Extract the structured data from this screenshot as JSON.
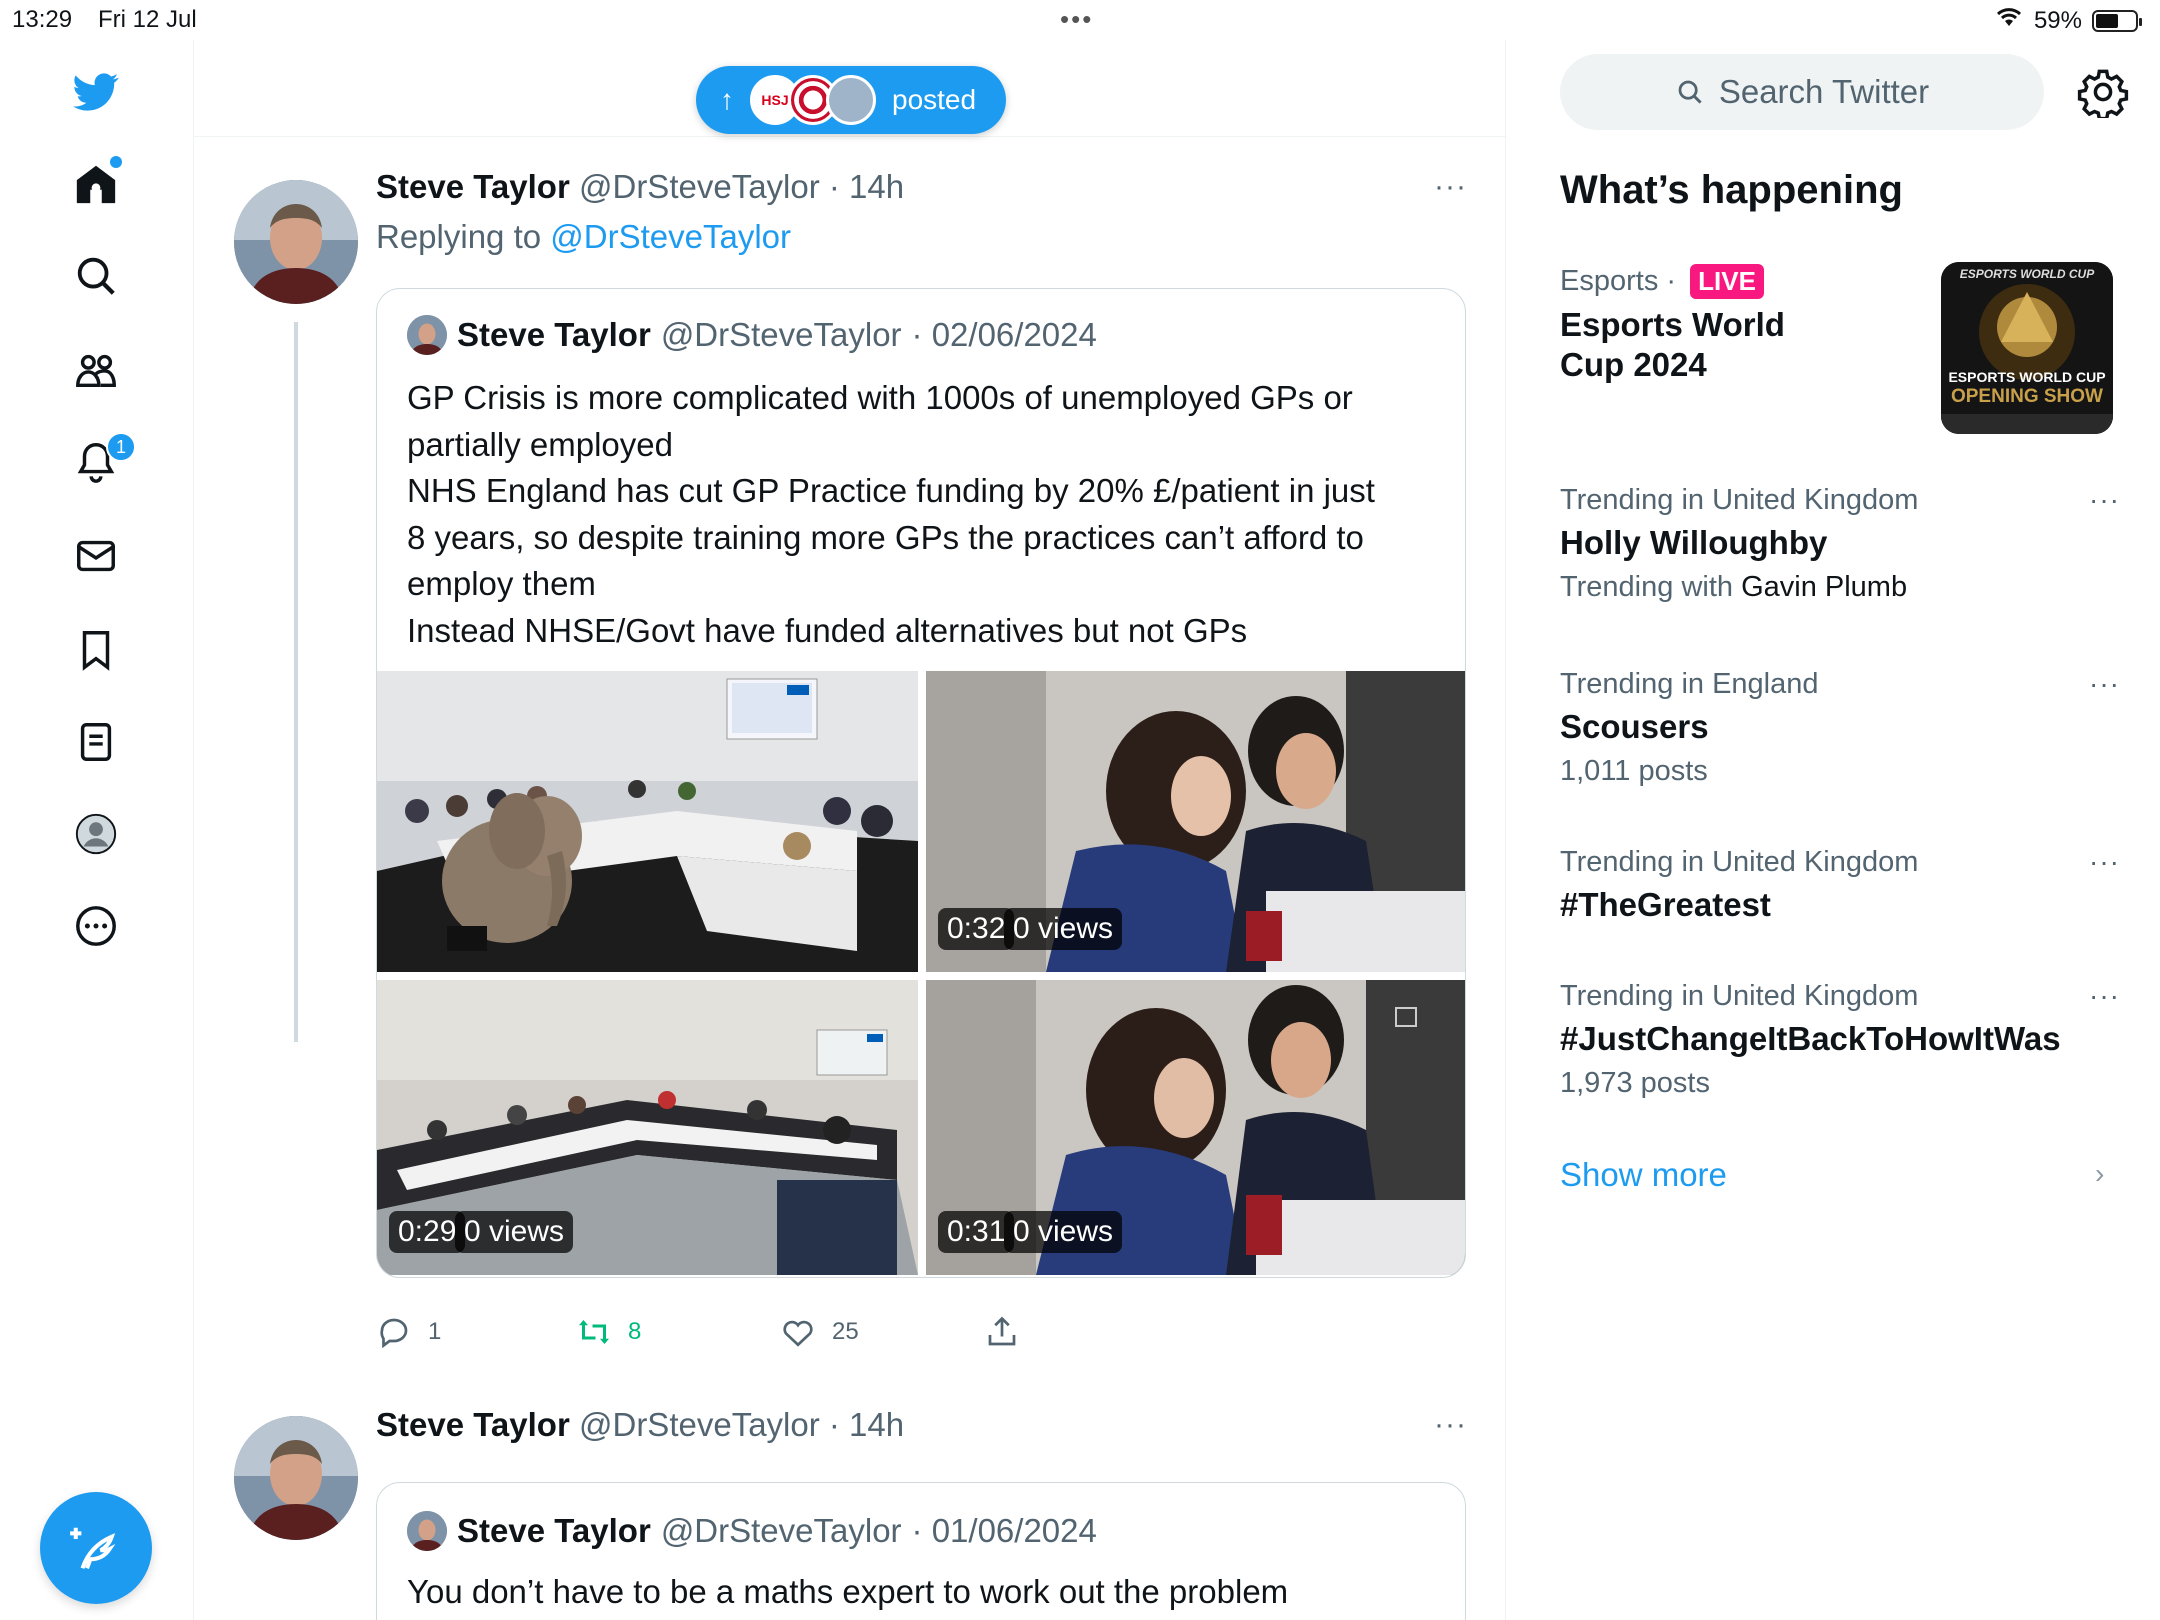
{
  "status_bar": {
    "time": "13:29",
    "date": "Fri 12 Jul",
    "battery": "59%",
    "battery_level": 0.59
  },
  "nav": {
    "notifications_badge": "1"
  },
  "topbar": {
    "posted_label": "posted",
    "pill_avatar_1": "HSJ"
  },
  "tweets": [
    {
      "name": "Steve Taylor",
      "handle": "@DrSteveTaylor",
      "time": "· 14h",
      "more": "···",
      "replying_prefix": "Replying to",
      "replying_to": "@DrSteveTaylor",
      "quote": {
        "name": "Steve Taylor",
        "handle": "@DrSteveTaylor",
        "date": "· 02/06/2024",
        "text_lines": [
          "GP Crisis is more complicated with 1000s of unemployed GPs or",
          "partially employed",
          "NHS England has cut GP Practice funding by 20% £/patient in just",
          "8 years, so despite training more GPs the practices can’t afford to",
          "employ them",
          "Instead NHSE/Govt have funded alternatives but not GPs"
        ],
        "media": [
          {
            "duration": "",
            "views": ""
          },
          {
            "duration": "0:32",
            "views": "0 views"
          },
          {
            "duration": "0:29",
            "views": "0 views"
          },
          {
            "duration": "0:31",
            "views": "0 views"
          }
        ]
      },
      "actions": {
        "replies": "1",
        "retweets": "8",
        "likes": "25"
      }
    },
    {
      "name": "Steve Taylor",
      "handle": "@DrSteveTaylor",
      "time": "· 14h",
      "more": "···",
      "quote": {
        "name": "Steve Taylor",
        "handle": "@DrSteveTaylor",
        "date": "· 01/06/2024",
        "text": "You don’t have to be a maths expert to work out the problem"
      }
    }
  ],
  "sidebar": {
    "search_placeholder": "Search Twitter",
    "whats_happening": "What’s happening",
    "trends": [
      {
        "context": "Esports",
        "sep": "·",
        "live": "LIVE",
        "title_lines": [
          "Esports World",
          "Cup 2024"
        ],
        "thumb_top": "ESPORTS WORLD CUP",
        "thumb_mid": "ESPORTS WORLD CUP",
        "thumb_bottom": "OPENING SHOW"
      },
      {
        "context": "Trending in United Kingdom",
        "title": "Holly Willoughby",
        "sub_prefix": "Trending with",
        "sub_link": "Gavin Plumb",
        "more": "···"
      },
      {
        "context": "Trending in England",
        "title": "Scousers",
        "sub": "1,011 posts",
        "more": "···"
      },
      {
        "context": "Trending in United Kingdom",
        "title": "#TheGreatest",
        "more": "···"
      },
      {
        "context": "Trending in United Kingdom",
        "title": "#JustChangeItBackToHowItWas",
        "sub": "1,973 posts",
        "more": "···"
      }
    ],
    "show_more": "Show more",
    "chevron": "›"
  },
  "colors": {
    "accent": "#1d9bf0",
    "retweet": "#00ba7c",
    "live": "#f91880"
  }
}
